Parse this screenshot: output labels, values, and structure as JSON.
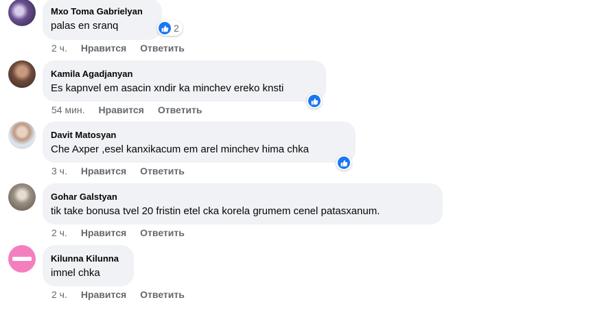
{
  "comments": [
    {
      "author": "Мхо Toma Gabrielyan",
      "text": "palas en sranq",
      "time": "2 ч.",
      "like_label": "Нравится",
      "reply_label": "Ответить",
      "reactions": {
        "icon": "like-icon",
        "count": "2"
      }
    },
    {
      "author": "Kamila Agadjanyan",
      "text": "Es kapnvel em asacin xndir ka minchev ereko knsti",
      "time": "54 мин.",
      "like_label": "Нравится",
      "reply_label": "Ответить",
      "reactions": {
        "icon": "like-icon",
        "count": ""
      }
    },
    {
      "author": "Davit Matosyan",
      "text": "Che Axper ,esel kanxikacum em arel minchev hima chka",
      "time": "3 ч.",
      "like_label": "Нравится",
      "reply_label": "Ответить",
      "reactions": {
        "icon": "like-icon",
        "count": ""
      }
    },
    {
      "author": "Gohar Galstyan",
      "text": "tik take bonusa tvel 20 fristin etel cka korela grumem cenel patasxanum.",
      "time": "2 ч.",
      "like_label": "Нравится",
      "reply_label": "Ответить"
    },
    {
      "author": "Kilunna Kilunna",
      "text": "imnel chka",
      "time": "2 ч.",
      "like_label": "Нравится",
      "reply_label": "Ответить"
    }
  ],
  "colors": {
    "like_blue": "#1877f2",
    "bubble_bg": "#f0f2f5",
    "meta_gray": "#65676b"
  }
}
